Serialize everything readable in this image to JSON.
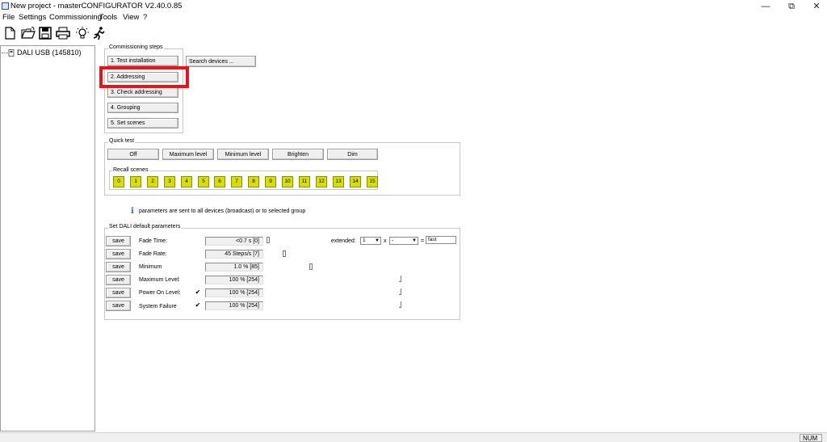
{
  "window": {
    "title": "New project - masterCONFIGURATOR V2.40.0.85",
    "minimize": "—",
    "restore": "⧉",
    "close": "✕"
  },
  "menu": [
    "File",
    "Settings",
    "Commissioning",
    "Tools",
    "View",
    "?"
  ],
  "toolbar": [
    "new-file-icon",
    "open-folder-icon",
    "save-icon",
    "print-icon",
    "bulb-icon",
    "run-icon"
  ],
  "tree": {
    "item": "DALI USB (145810)"
  },
  "commissioning": {
    "title": "Commissioning steps",
    "steps": [
      "1. Test installation",
      "2. Addressing",
      "3. Check addressing",
      "4. Grouping",
      "5. Set scenes"
    ],
    "search_button": "Search devices ..."
  },
  "quick_test": {
    "title": "Quick test",
    "buttons": [
      "Off",
      "Maximum level",
      "Minimum level",
      "Brighten",
      "Dim"
    ],
    "recall_title": "Recall scenes",
    "scenes": [
      "0",
      "1",
      "2",
      "3",
      "4",
      "5",
      "6",
      "7",
      "8",
      "9",
      "10",
      "11",
      "12",
      "13",
      "14",
      "15"
    ]
  },
  "info": {
    "icon": "i",
    "text": "parameters are sent to all devices (broadcast) or to selected group"
  },
  "dali_params": {
    "title": "Set DALI default parameters",
    "save_label": "save",
    "rows": [
      {
        "label": "Fade Time:",
        "value": "<0.7  s [0]",
        "checked": null,
        "slider": 0.0
      },
      {
        "label": "Fade Rate:",
        "value": "45  Steps/s [7]",
        "checked": null,
        "slider": 0.47
      },
      {
        "label": "Minimum",
        "value": "1.0 % [85]",
        "checked": null,
        "slider": 0.34
      },
      {
        "label": "Maximum Level:",
        "value": "100 % [254]",
        "checked": null,
        "slider": 1.0
      },
      {
        "label": "Power On Level:",
        "value": "100 % [254]",
        "checked": true,
        "slider": 1.0
      },
      {
        "label": "System Failure",
        "value": "100 % [254]",
        "checked": true,
        "slider": 1.0
      }
    ],
    "extended_label": "extended:",
    "extended_value1": "1",
    "x_label": "x",
    "extended_value2": "-",
    "equals": "=",
    "result": "fast"
  },
  "status": {
    "num": "NUM"
  },
  "colors": {
    "highlight": "#e8141b",
    "scene_button": "#d6df00"
  }
}
